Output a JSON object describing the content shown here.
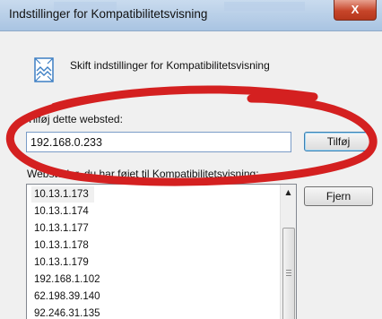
{
  "dialog": {
    "title": "Indstillinger for Kompatibilitetsvisning",
    "close_label": "X",
    "header_text": "Skift indstillinger for Kompatibilitetsvisning"
  },
  "add_section": {
    "label": "Tilføj dette websted:",
    "input_value": "192.168.0.233",
    "add_button": "Tilføj"
  },
  "list_section": {
    "label": "Websteder, du har føjet til Kompatibilitetsvisning:",
    "remove_button": "Fjern",
    "items": [
      "10.13.1.173",
      "10.13.1.174",
      "10.13.1.177",
      "10.13.1.178",
      "10.13.1.179",
      "192.168.1.102",
      "62.198.39.140",
      "92.246.31.135"
    ]
  },
  "annotation": {
    "color": "#d42020"
  }
}
